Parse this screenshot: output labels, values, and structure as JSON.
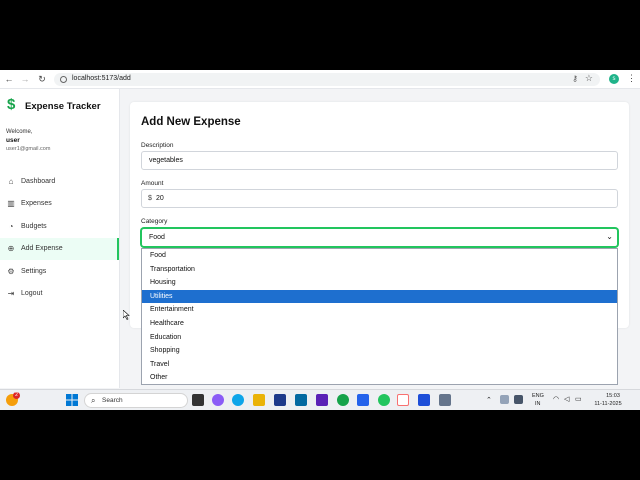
{
  "browser": {
    "url": "localhost:5173/add",
    "profile_initial": "s"
  },
  "app": {
    "title": "Expense Tracker",
    "welcome": "Welcome,",
    "username": "user",
    "email": "user1@gmail.com"
  },
  "sidebar": {
    "items": [
      {
        "label": "Dashboard",
        "icon": "home-icon"
      },
      {
        "label": "Expenses",
        "icon": "bar-chart-icon"
      },
      {
        "label": "Budgets",
        "icon": "pie-chart-icon"
      },
      {
        "label": "Add Expense",
        "icon": "plus-circle-icon"
      },
      {
        "label": "Settings",
        "icon": "gear-icon"
      },
      {
        "label": "Logout",
        "icon": "logout-icon"
      }
    ]
  },
  "form": {
    "title": "Add New Expense",
    "description_label": "Description",
    "description_value": "vegetables",
    "amount_label": "Amount",
    "currency": "$",
    "amount_value": "20",
    "category_label": "Category",
    "category_value": "Food",
    "category_options": [
      "Food",
      "Transportation",
      "Housing",
      "Utilities",
      "Entertainment",
      "Healthcare",
      "Education",
      "Shopping",
      "Travel",
      "Other"
    ],
    "highlighted_option": "Utilities"
  },
  "taskbar": {
    "search_placeholder": "Search",
    "lang": "ENG",
    "region": "IN",
    "time": "15:03",
    "date": "11-11-2025",
    "weather_badge": "2"
  },
  "colors": {
    "accent": "#22c55e",
    "highlight": "#1e6fcf"
  }
}
